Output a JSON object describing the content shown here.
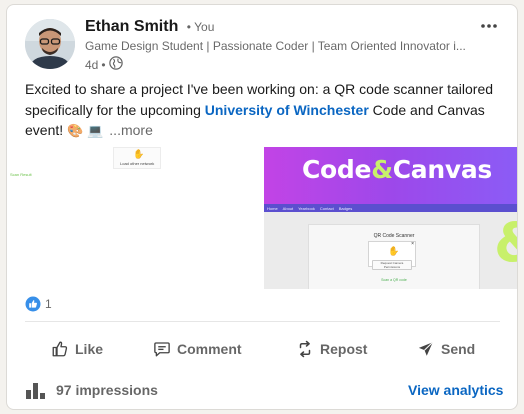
{
  "post": {
    "author_name": "Ethan Smith",
    "author_degree": "• You",
    "headline": "Game Design Student | Passionate Coder | Team Oriented Innovator i...",
    "time_ago": "4d",
    "meta_separator": "•",
    "visibility_icon": "globe-icon",
    "more_icon": "ellipsis-icon",
    "text_part1": "Excited to share a project I've been working on: a QR code scanner tailored specifically for the upcoming ",
    "hashtag": "University of Winchester",
    "text_part2": " Code and Canvas event! ",
    "emoji_1": "🎨",
    "emoji_2": "💻",
    "see_more": "...more"
  },
  "media": {
    "banner_title_part1": "Code",
    "banner_amp": "&",
    "banner_title_part2": "Canvas",
    "subnav": [
      "Home",
      "About",
      "Yearbook",
      "Contact",
      "Badges"
    ],
    "scanner_title": "QR Code Scanner",
    "scanner_close": "×",
    "scanner_glyph": "✋",
    "scanner_button": "Request Camera Permissions",
    "green_note": "Scan a QR code",
    "thumb_label": "Load other network",
    "left_green": "Scan Result",
    "big_amp": "&"
  },
  "reactions": {
    "count": "1",
    "icon": "thumbs-up-reaction-icon"
  },
  "actions": {
    "like": "Like",
    "comment": "Comment",
    "repost": "Repost",
    "send": "Send"
  },
  "footer": {
    "impressions": "97 impressions",
    "analytics_link": "View analytics"
  },
  "colors": {
    "link_blue": "#0a66c2",
    "banner_purple": "#b145e8",
    "accent_lime": "#c8f06b"
  }
}
